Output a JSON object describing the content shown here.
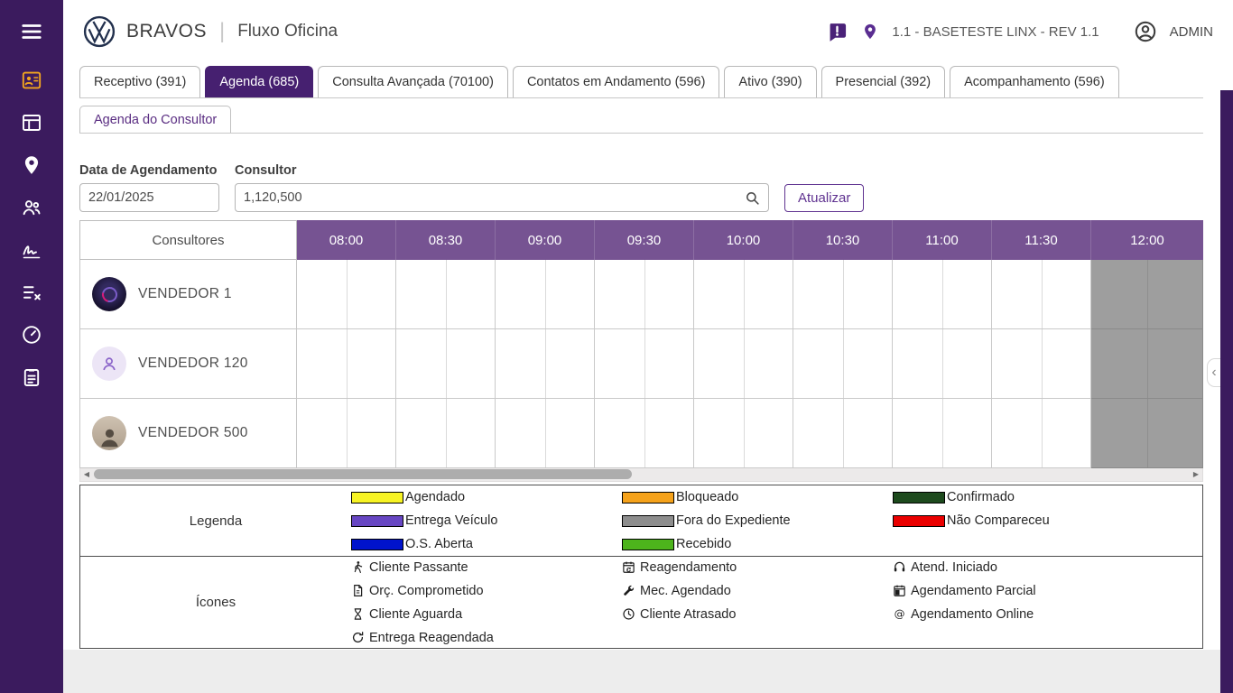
{
  "colors": {
    "sidebar": "#3b1b5e",
    "active_tab": "#462070",
    "table_header": "#765392",
    "accent": "#5f3290",
    "out_of_hours": "#9e9e9e"
  },
  "sidebar": {
    "menu_icon": "menu-icon",
    "items": [
      {
        "icon": "contacts-icon",
        "active": true
      },
      {
        "icon": "list-icon"
      },
      {
        "icon": "map-pin-icon"
      },
      {
        "icon": "people-icon"
      },
      {
        "icon": "signature-icon"
      },
      {
        "icon": "tasks-icon"
      },
      {
        "icon": "gauge-icon"
      },
      {
        "icon": "clipboard-icon"
      }
    ]
  },
  "header": {
    "logo_icon": "vw-logo-icon",
    "brand": "BRAVOS",
    "module": "Fluxo Oficina",
    "notification_icon": "chat-alert-icon",
    "location_icon": "map-pin-icon",
    "environment": "1.1 - BASETESTE LINX - REV 1.1",
    "user_icon": "user-circle-icon",
    "user": "ADMIN"
  },
  "tabs": [
    {
      "label": "Receptivo (391)",
      "active": false
    },
    {
      "label": "Agenda (685)",
      "active": true
    },
    {
      "label": "Consulta Avançada (70100)",
      "active": false
    },
    {
      "label": "Contatos em Andamento (596)",
      "active": false
    },
    {
      "label": "Ativo (390)",
      "active": false
    },
    {
      "label": "Presencial (392)",
      "active": false
    },
    {
      "label": "Acompanhamento (596)",
      "active": false
    }
  ],
  "subtab": {
    "label": "Agenda do Consultor"
  },
  "filters": {
    "date": {
      "label": "Data de Agendamento",
      "value": "22/01/2025",
      "icon": "calendar-icon"
    },
    "consultor": {
      "label": "Consultor",
      "value": "1,120,500",
      "icon": "search-icon"
    },
    "update_button": "Atualizar"
  },
  "schedule": {
    "first_column_header": "Consultores",
    "time_slots": [
      "08:00",
      "08:30",
      "09:00",
      "09:30",
      "10:00",
      "10:30",
      "11:00",
      "11:30",
      "12:00"
    ],
    "out_of_hours_slots": [
      "12:00"
    ],
    "consultants": [
      {
        "name": "VENDEDOR 1",
        "avatar": "logo"
      },
      {
        "name": "VENDEDOR 120",
        "avatar": "person"
      },
      {
        "name": "VENDEDOR 500",
        "avatar": "photo"
      }
    ]
  },
  "legend": {
    "title": "Legenda",
    "items": [
      {
        "label": "Agendado",
        "color": "#f7f324"
      },
      {
        "label": "Bloqueado",
        "color": "#f5a21b"
      },
      {
        "label": "Confirmado",
        "color": "#1d4a1d"
      },
      {
        "label": "Entrega Veículo",
        "color": "#6746c3"
      },
      {
        "label": "Fora do Expediente",
        "color": "#8d8d8d"
      },
      {
        "label": "Não Compareceu",
        "color": "#ea0000"
      },
      {
        "label": "O.S. Aberta",
        "color": "#0013cc"
      },
      {
        "label": "Recebido",
        "color": "#4db41c"
      }
    ]
  },
  "icons_legend": {
    "title": "Ícones",
    "items": [
      {
        "icon": "walking-person-icon",
        "label": "Cliente Passante"
      },
      {
        "icon": "calendar-sync-icon",
        "label": "Reagendamento"
      },
      {
        "icon": "headset-icon",
        "label": "Atend. Iniciado"
      },
      {
        "icon": "budget-doc-icon",
        "label": "Orç. Comprometido"
      },
      {
        "icon": "wrench-icon",
        "label": "Mec. Agendado"
      },
      {
        "icon": "calendar-partial-icon",
        "label": "Agendamento Parcial"
      },
      {
        "icon": "hourglass-icon",
        "label": "Cliente Aguarda"
      },
      {
        "icon": "clock-icon",
        "label": "Cliente Atrasado"
      },
      {
        "icon": "at-icon",
        "label": "Agendamento Online"
      },
      {
        "icon": "redo-icon",
        "label": "Entrega Reagendada"
      }
    ]
  },
  "scrollbar": {
    "left_arrow": "◀",
    "right_arrow": "▶"
  },
  "collapse_chevron": "‹"
}
